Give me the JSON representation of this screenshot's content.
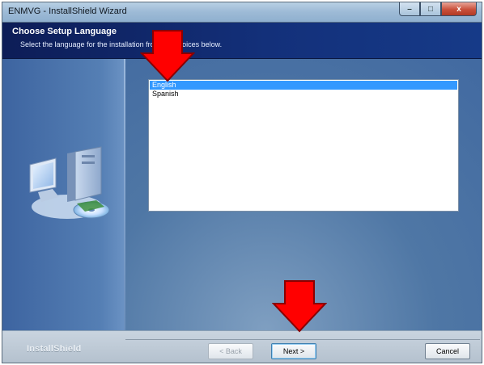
{
  "window": {
    "title": "ENMVG - InstallShield Wizard",
    "controls": {
      "minimize": "–",
      "maximize": "□",
      "close": "x"
    }
  },
  "header": {
    "title": "Choose Setup Language",
    "subtitle": "Select the language for the installation from the choices below."
  },
  "language_list": {
    "items": [
      {
        "label": "English",
        "selected": true
      },
      {
        "label": "Spanish",
        "selected": false
      }
    ]
  },
  "footer": {
    "brand": "InstallShield",
    "back_label": "< Back",
    "next_label": "Next >",
    "cancel_label": "Cancel"
  },
  "colors": {
    "header_bg": "#13307a",
    "selection": "#3399ff",
    "annotation_arrow": "#ff0000"
  },
  "icons": [
    "computer-install-icon",
    "down-arrow-annotation-icon"
  ]
}
